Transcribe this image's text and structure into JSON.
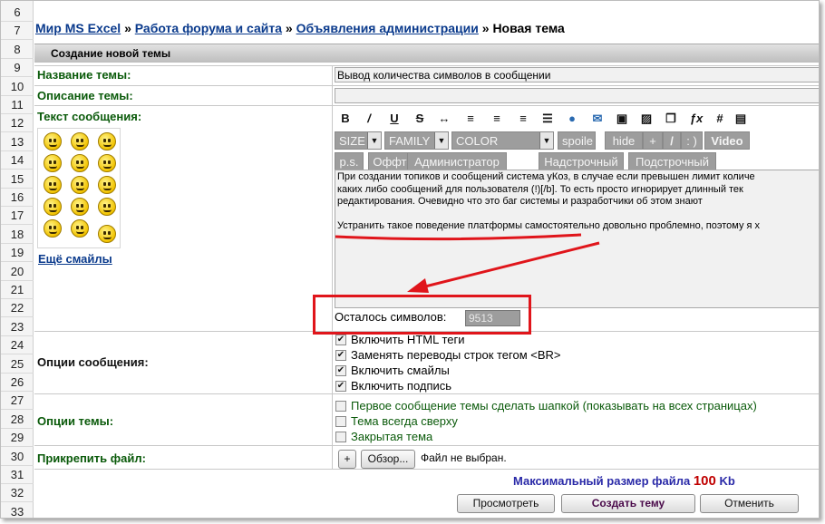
{
  "breadcrumb": {
    "items": [
      "Мир MS Excel",
      "Работа форума и сайта",
      "Объявления администрации"
    ],
    "current": "Новая тема",
    "separator": "»"
  },
  "gutter": {
    "rows": [
      "6",
      "7",
      "8",
      "9",
      "10",
      "11",
      "12",
      "13",
      "14",
      "15",
      "16",
      "17",
      "18",
      "19",
      "20",
      "21",
      "22",
      "23",
      "24",
      "25",
      "26",
      "27",
      "28",
      "29",
      "30",
      "31",
      "32",
      "33"
    ]
  },
  "form": {
    "header": "Создание новой темы",
    "topic_title_label": "Название темы:",
    "topic_title_value": "Вывод количества символов в сообщении",
    "topic_desc_label": "Описание темы:",
    "topic_desc_value": "",
    "message_label": "Текст сообщения:",
    "more_smiles": "Ещё смайлы",
    "toolbar": {
      "icons": [
        "bold-icon",
        "italic-icon",
        "underline-icon",
        "strike-icon",
        "hr-icon",
        "align-left-icon",
        "align-center-icon",
        "align-right-icon",
        "list-icon",
        "url-icon",
        "email-icon",
        "image-icon",
        "image-upload-icon",
        "quote-icon",
        "formula-icon",
        "hash-icon",
        "table-icon"
      ],
      "size": "SIZE",
      "family": "FAMILY",
      "color": "COLOR",
      "spoiler": "spoile",
      "hide": "hide",
      "plus": "+",
      "slash": "/",
      "colon_paren": ": )",
      "video": "Video",
      "ps": "p.s.",
      "offtop": "Оффтоп",
      "admin": "Администратор",
      "sup": "Надстрочный",
      "sub": "Подстрочный"
    },
    "message_lines": [
      "При создании топиков и сообщений система уКоз, в случае если превышен лимит количе",
      "каких либо сообщений для пользователя (!)[/b]. То есть просто игнорирует длинный тек",
      "редактирования. Очевидно что это баг системы и разработчики об этом знают",
      "",
      "Устранить такое поведение платформы самостоятельно довольно проблемно, поэтому я х"
    ],
    "remaining_label": "Осталось символов:",
    "remaining_value": "9513",
    "message_options_label": "Опции сообщения:",
    "message_options": [
      {
        "label": "Включить HTML теги",
        "checked": true
      },
      {
        "label": "Заменять переводы строк тегом <BR>",
        "checked": true
      },
      {
        "label": "Включить смайлы",
        "checked": true
      },
      {
        "label": "Включить подпись",
        "checked": true
      }
    ],
    "topic_options_label": "Опции темы:",
    "topic_options": [
      {
        "label": "Первое сообщение темы сделать шапкой (показывать на всех страницах)",
        "checked": false
      },
      {
        "label": "Тема всегда сверху",
        "checked": false
      },
      {
        "label": "Закрытая тема",
        "checked": false
      }
    ],
    "attach_label": "Прикрепить файл:",
    "attach_plus": "+",
    "browse_button": "Обзор...",
    "no_file": "Файл не выбран.",
    "max_size_prefix": "Максимальный размер файла",
    "max_size_value": "100",
    "max_size_unit": "Kb",
    "preview_button": "Просмотреть",
    "submit_button": "Создать тему",
    "cancel_button": "Отменить"
  },
  "colors": {
    "label_green": "#0a5a0a",
    "link_blue": "#0a3a8c",
    "annotation_red": "#e0151b",
    "toolbar_gray": "#9d9d9d"
  }
}
